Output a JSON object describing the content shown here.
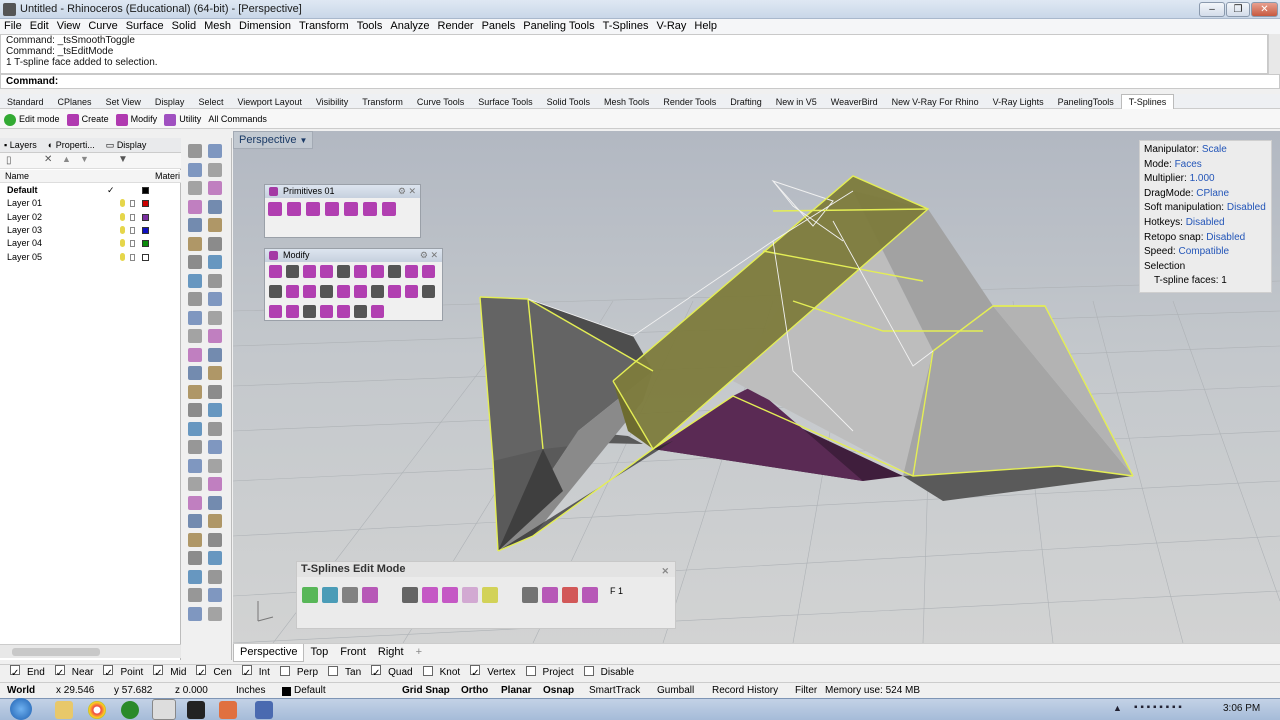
{
  "window": {
    "title": "Untitled - Rhinoceros (Educational) (64-bit) - [Perspective]",
    "minimize": "–",
    "restore": "❐",
    "close": "✕"
  },
  "menu": [
    "File",
    "Edit",
    "View",
    "Curve",
    "Surface",
    "Solid",
    "Mesh",
    "Dimension",
    "Transform",
    "Tools",
    "Analyze",
    "Render",
    "Panels",
    "Paneling Tools",
    "T-Splines",
    "V-Ray",
    "Help"
  ],
  "command_history": [
    "Command: _tsSmoothToggle",
    "Command: _tsEditMode",
    "1 T-spline face added to selection."
  ],
  "command_prompt": "Command:",
  "toolbar_tabs": [
    "Standard",
    "CPlanes",
    "Set View",
    "Display",
    "Select",
    "Viewport Layout",
    "Visibility",
    "Transform",
    "Curve Tools",
    "Surface Tools",
    "Solid Tools",
    "Mesh Tools",
    "Render Tools",
    "Drafting",
    "New in V5",
    "WeaverBird",
    "New V-Ray For Rhino",
    "V-Ray Lights",
    "PanelingTools",
    "T-Splines"
  ],
  "tsplines_toolbar": [
    "Edit mode",
    "Create",
    "Modify",
    "Utility",
    "All Commands"
  ],
  "left_panel": {
    "tabs": [
      "Layers",
      "Properti...",
      "Display"
    ],
    "columns": {
      "name": "Name",
      "material": "Materi"
    },
    "layers": [
      {
        "name": "Default",
        "color": "#000000",
        "current": "✓"
      },
      {
        "name": "Layer 01",
        "color": "#cc0000"
      },
      {
        "name": "Layer 02",
        "color": "#7a2fa0"
      },
      {
        "name": "Layer 03",
        "color": "#1010c0"
      },
      {
        "name": "Layer 04",
        "color": "#0a8a0a"
      },
      {
        "name": "Layer 05",
        "color": "#ffffff"
      }
    ]
  },
  "viewport": {
    "label": "Perspective"
  },
  "floating_panels": {
    "primitives": "Primitives 01",
    "modify": "Modify"
  },
  "hud": {
    "manipulator_label": "Manipulator:",
    "manipulator": "Scale",
    "mode_label": "Mode:",
    "mode": "Faces",
    "multiplier_label": "Multiplier:",
    "multiplier": "1.000",
    "dragmode_label": "DragMode:",
    "dragmode": "CPlane",
    "soft_label": "Soft manipulation:",
    "soft": "Disabled",
    "hotkeys_label": "Hotkeys:",
    "hotkeys": "Disabled",
    "retopo_label": "Retopo snap:",
    "retopo": "Disabled",
    "speed_label": "Speed:",
    "speed": "Compatible",
    "selection_label": "Selection",
    "faces_label": "T-spline faces:",
    "faces": "1"
  },
  "tsplines_panel": {
    "title": "T-Splines Edit Mode",
    "fkey": "F 1"
  },
  "viewport_tabs": [
    "Perspective",
    "Top",
    "Front",
    "Right"
  ],
  "osnaps": [
    {
      "label": "End",
      "checked": true
    },
    {
      "label": "Near",
      "checked": true
    },
    {
      "label": "Point",
      "checked": true
    },
    {
      "label": "Mid",
      "checked": true
    },
    {
      "label": "Cen",
      "checked": true
    },
    {
      "label": "Int",
      "checked": true
    },
    {
      "label": "Perp",
      "checked": false
    },
    {
      "label": "Tan",
      "checked": false
    },
    {
      "label": "Quad",
      "checked": true
    },
    {
      "label": "Knot",
      "checked": false
    },
    {
      "label": "Vertex",
      "checked": true
    },
    {
      "label": "Project",
      "checked": false
    },
    {
      "label": "Disable",
      "checked": false
    }
  ],
  "status": {
    "cplane": "World",
    "x": "x 29.546",
    "y": "y 57.682",
    "z": "z 0.000",
    "units": "Inches",
    "layer": "Default",
    "grid_snap": "Grid Snap",
    "ortho": "Ortho",
    "planar": "Planar",
    "osnap": "Osnap",
    "smarttrack": "SmartTrack",
    "gumball": "Gumball",
    "record_history": "Record History",
    "filter": "Filter",
    "memory": "Memory use: 524 MB"
  },
  "taskbar": {
    "clock": "3:06 PM"
  }
}
